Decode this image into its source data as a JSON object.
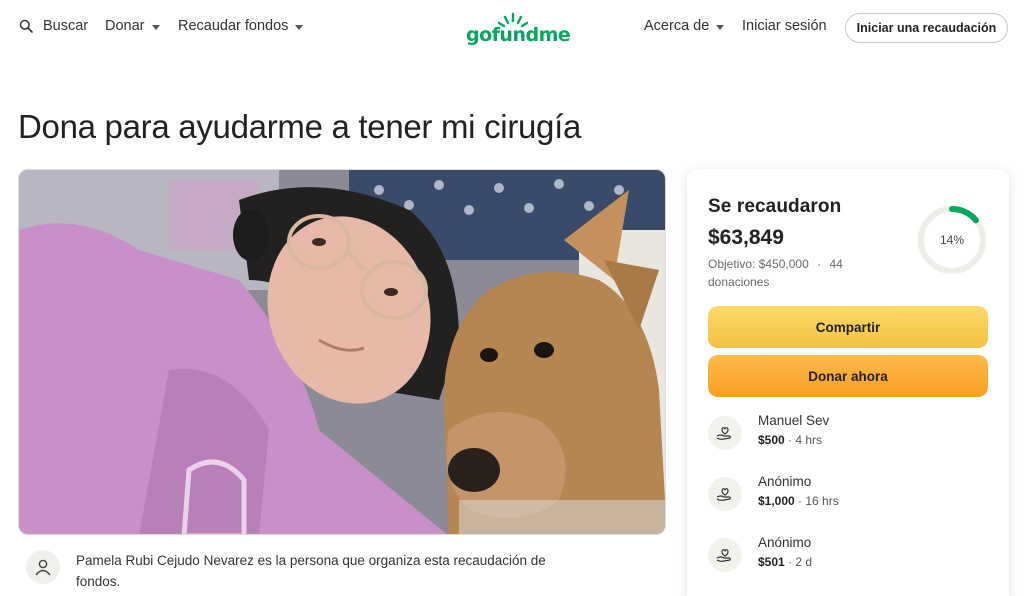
{
  "header": {
    "search_label": "Buscar",
    "donate_label": "Donar",
    "fundraise_label": "Recaudar fondos",
    "logo_text": "gofundme",
    "about_label": "Acerca de",
    "signin_label": "Iniciar sesión",
    "start_label": "Iniciar una recaudación"
  },
  "page": {
    "title": "Dona para ayudarme a tener mi cirugía"
  },
  "organizer": {
    "text": "Pamela Rubi Cejudo Nevarez es la persona que organiza esta recaudación de fondos."
  },
  "campaign": {
    "raised_label": "Se recaudaron",
    "raised_amount": "$63,849",
    "goal_text": "Objetivo: $450,000",
    "separator": "·",
    "donations_count": "44 donaciones",
    "progress_label": "14%",
    "progress_fraction": 0.14,
    "share_label": "Compartir",
    "donate_now_label": "Donar ahora"
  },
  "donations": [
    {
      "name": "Manuel Sev",
      "amount": "$500",
      "time": "· 4 hrs"
    },
    {
      "name": "Anónimo",
      "amount": "$1,000",
      "time": "· 16 hrs"
    },
    {
      "name": "Anónimo",
      "amount": "$501",
      "time": "· 2 d"
    }
  ],
  "colors": {
    "brand_green": "#02a95c",
    "share_yellow": "#f6c342",
    "donate_orange": "#f89f22"
  }
}
